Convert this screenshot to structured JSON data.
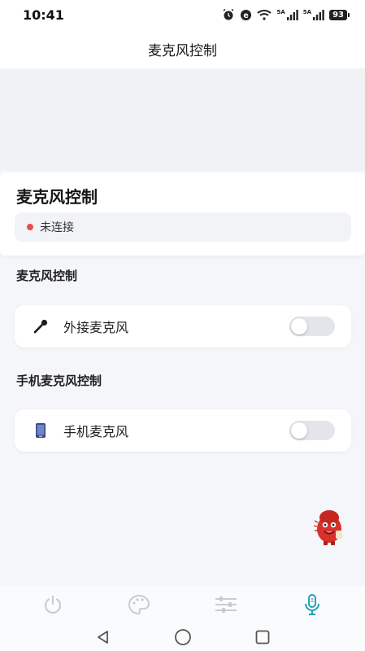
{
  "status_bar": {
    "time": "10:41",
    "network_label_1": "5A",
    "network_label_2": "5A",
    "battery": "93",
    "icons": [
      "alarm-icon",
      "app-notification-icon",
      "wifi-icon",
      "signal-icon",
      "signal-icon",
      "battery-icon"
    ]
  },
  "header": {
    "title": "麦克风控制"
  },
  "connection": {
    "heading": "麦克风控制",
    "status_text": "未连接",
    "status_color": "#e84a4a"
  },
  "sections": [
    {
      "label": "麦克风控制",
      "item": {
        "label": "外接麦克风",
        "icon": "microphone-icon",
        "enabled": false
      }
    },
    {
      "label": "手机麦克风控制",
      "item": {
        "label": "手机麦克风",
        "icon": "phone-icon",
        "enabled": false
      }
    }
  ],
  "bottom_nav": {
    "items": [
      {
        "icon": "power-icon",
        "active": false
      },
      {
        "icon": "palette-icon",
        "active": false
      },
      {
        "icon": "sliders-icon",
        "active": false
      },
      {
        "icon": "microphone-icon",
        "active": true
      }
    ],
    "active_color": "#2aa0b8",
    "inactive_color": "#c8ccd2"
  },
  "system_nav": {
    "icons": [
      "back-icon",
      "home-icon",
      "recents-icon"
    ]
  }
}
